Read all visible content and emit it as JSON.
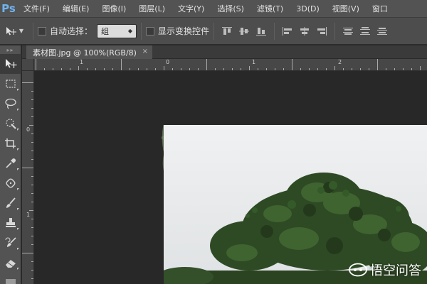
{
  "app": {
    "logo": "Ps"
  },
  "menu": [
    "文件(F)",
    "编辑(E)",
    "图像(I)",
    "图层(L)",
    "文字(Y)",
    "选择(S)",
    "滤镜(T)",
    "3D(D)",
    "视图(V)",
    "窗口"
  ],
  "options": {
    "auto_select_label": "自动选择：",
    "auto_select_value": "组",
    "show_transform_label": "显示变换控件"
  },
  "document": {
    "tab_label": "素材图.jpg @ 100%(RGB/8)",
    "close_glyph": "×"
  },
  "ruler": {
    "h_labels": [
      "1",
      "0",
      "1",
      "2"
    ],
    "v_labels": [
      "0",
      "1"
    ]
  },
  "watermark": {
    "text": "悟空问答"
  },
  "colors": {
    "menubar": "#535353",
    "optbar": "#4d4d4d",
    "canvas": "#282828",
    "ps_blue": "#6fb3ef",
    "sky": "#e9eaec",
    "foliage_dark": "#2e4a24",
    "foliage_mid": "#3f6430"
  },
  "icons": {
    "move": "move-tool-icon",
    "marquee": "rect-marquee-icon",
    "lasso": "lasso-icon",
    "quick_select": "quick-select-icon",
    "crop": "crop-icon",
    "eyedropper": "eyedropper-icon",
    "healing": "healing-brush-icon",
    "brush": "brush-icon",
    "stamp": "clone-stamp-icon",
    "history_brush": "history-brush-icon",
    "eraser": "eraser-icon"
  }
}
